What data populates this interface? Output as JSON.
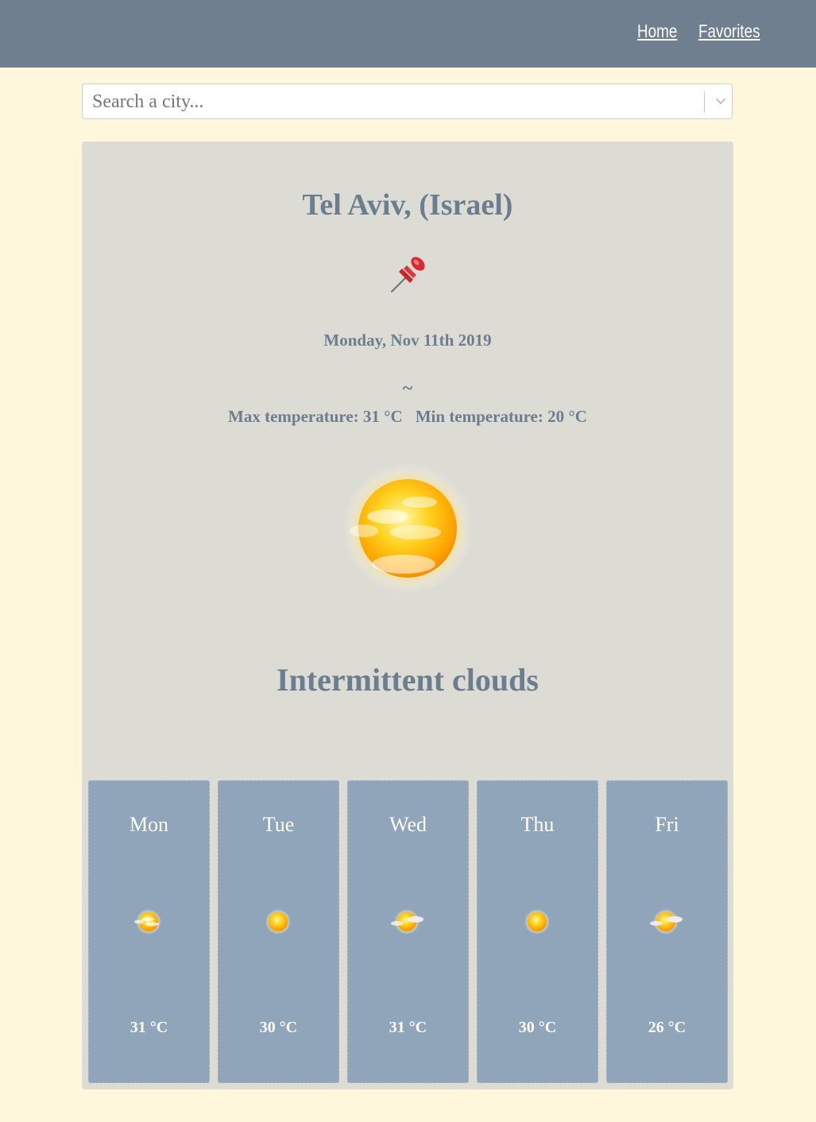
{
  "nav": {
    "home_label": "Home",
    "favorites_label": "Favorites"
  },
  "search": {
    "placeholder": "Search a city..."
  },
  "weather": {
    "city": "Tel Aviv, (Israel)",
    "favorite_icon": "pushpin-icon",
    "date": "Monday, Nov 11th 2019",
    "separator": "~",
    "max_temp": "Max temperature: 31 °C",
    "min_temp": "Min temperature: 20 °C",
    "condition_icon": "sun-cloud-icon",
    "description": "Intermittent clouds"
  },
  "forecast": [
    {
      "day": "Mon",
      "temp": "31 °C",
      "icon": "sun-clouds-icon"
    },
    {
      "day": "Tue",
      "temp": "30 °C",
      "icon": "sun-icon"
    },
    {
      "day": "Wed",
      "temp": "31 °C",
      "icon": "sun-cloud-icon"
    },
    {
      "day": "Thu",
      "temp": "30 °C",
      "icon": "sun-icon"
    },
    {
      "day": "Fri",
      "temp": "26 °C",
      "icon": "sun-cloud-icon"
    }
  ],
  "colors": {
    "page_background": "#fff7db",
    "topbar": "#6f7f8f",
    "card": "#dcdcd4",
    "text_accent": "#6b7e8f",
    "forecast_tile": "#90a5b9"
  }
}
